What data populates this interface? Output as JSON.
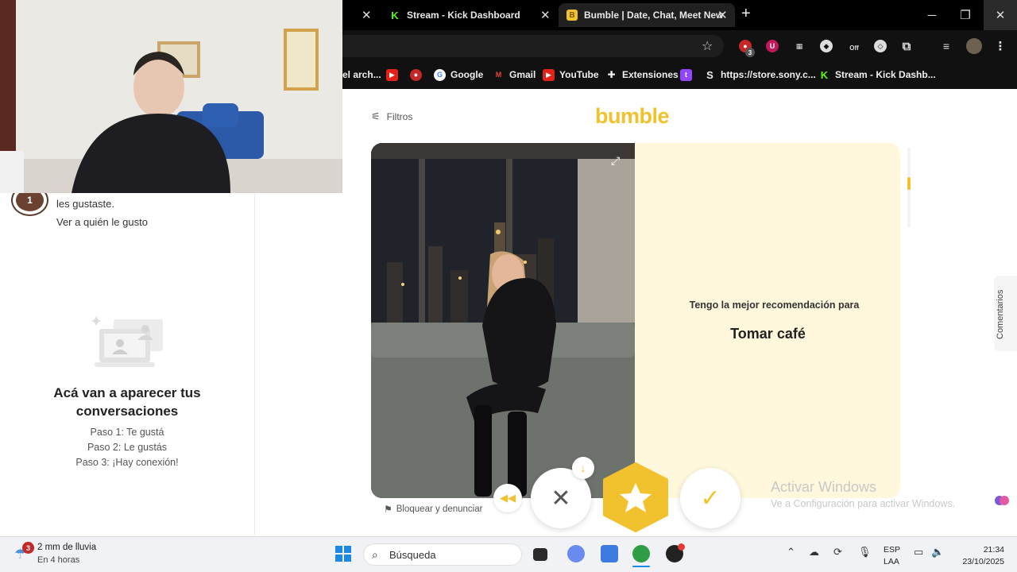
{
  "browser": {
    "tabs": [
      {
        "label": "Stream - Kick Dashboard",
        "active": false
      },
      {
        "label": "Bumble | Date, Chat, Meet New",
        "active": true
      }
    ],
    "bookmarks": [
      {
        "label": "el arch..."
      },
      {
        "label": "Google"
      },
      {
        "label": "Gmail"
      },
      {
        "label": "YouTube"
      },
      {
        "label": "Extensiones"
      },
      {
        "label": "https://store.sony.c..."
      },
      {
        "label": "Stream - Kick Dashb..."
      }
    ],
    "extension_badge": "3",
    "extension_off_label": "Off"
  },
  "sidebar": {
    "avatar_count": "1",
    "likes_text": "les gustaste.",
    "likes_link": "Ver a quién le gusto",
    "empty_title": "Acá van a aparecer tus conversaciones",
    "steps": [
      "Paso 1: Te gustá",
      "Paso 2: Le gustás",
      "Paso 3: ¡Hay conexión!"
    ]
  },
  "header": {
    "filters_label": "Filtros",
    "logo": "bumble"
  },
  "profile_card": {
    "recommendation_label": "Tengo la mejor recomendación para",
    "recommendation_value": "Tomar café",
    "report_label": "Bloquear y denunciar"
  },
  "watermark": {
    "title": "Activar Windows",
    "subtitle": "Ve a Configuración para activar Windows."
  },
  "feedback_tab": "Comentarios",
  "colors": {
    "accent": "#f2c12e",
    "card_bg": "#fff8dc"
  },
  "taskbar": {
    "weather_badge": "3",
    "weather_title": "2 mm de lluvia",
    "weather_sub": "En 4 horas",
    "search_placeholder": "Búsqueda",
    "lang_top": "ESP",
    "lang_bottom": "LAA",
    "time": "21:34",
    "date": "23/10/2025"
  }
}
